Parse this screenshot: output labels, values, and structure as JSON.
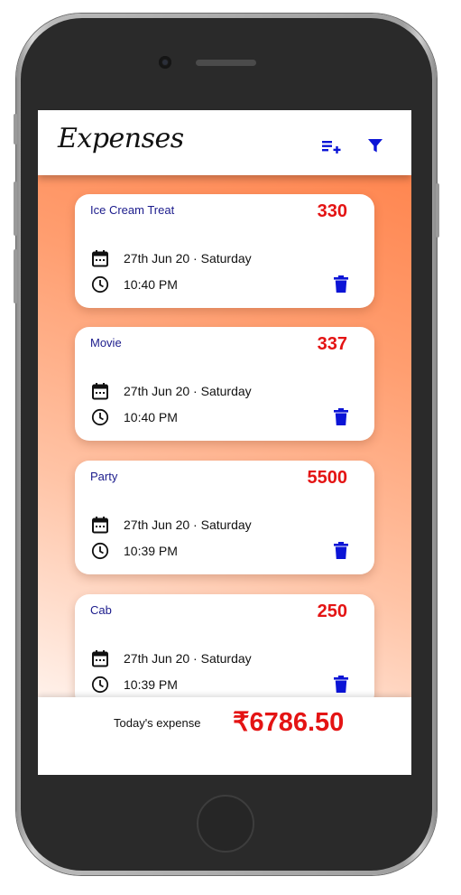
{
  "app": {
    "title": "Expenses",
    "accent_color": "#0b14d6",
    "amount_color": "#e41414",
    "actions": [
      {
        "icon": "playlist-add-icon"
      },
      {
        "icon": "filter-icon"
      }
    ]
  },
  "expenses": [
    {
      "title": "Ice Cream Treat",
      "amount": "330",
      "date": "27th Jun 20 · Saturday",
      "time": "10:40 PM"
    },
    {
      "title": "Movie",
      "amount": "337",
      "date": "27th Jun 20 · Saturday",
      "time": "10:40 PM"
    },
    {
      "title": "Party",
      "amount": "5500",
      "date": "27th Jun 20 · Saturday",
      "time": "10:39 PM"
    },
    {
      "title": "Cab",
      "amount": "250",
      "date": "27th Jun 20 · Saturday",
      "time": "10:39 PM"
    }
  ],
  "footer": {
    "label": "Today's expense",
    "total": "₹6786.50"
  }
}
